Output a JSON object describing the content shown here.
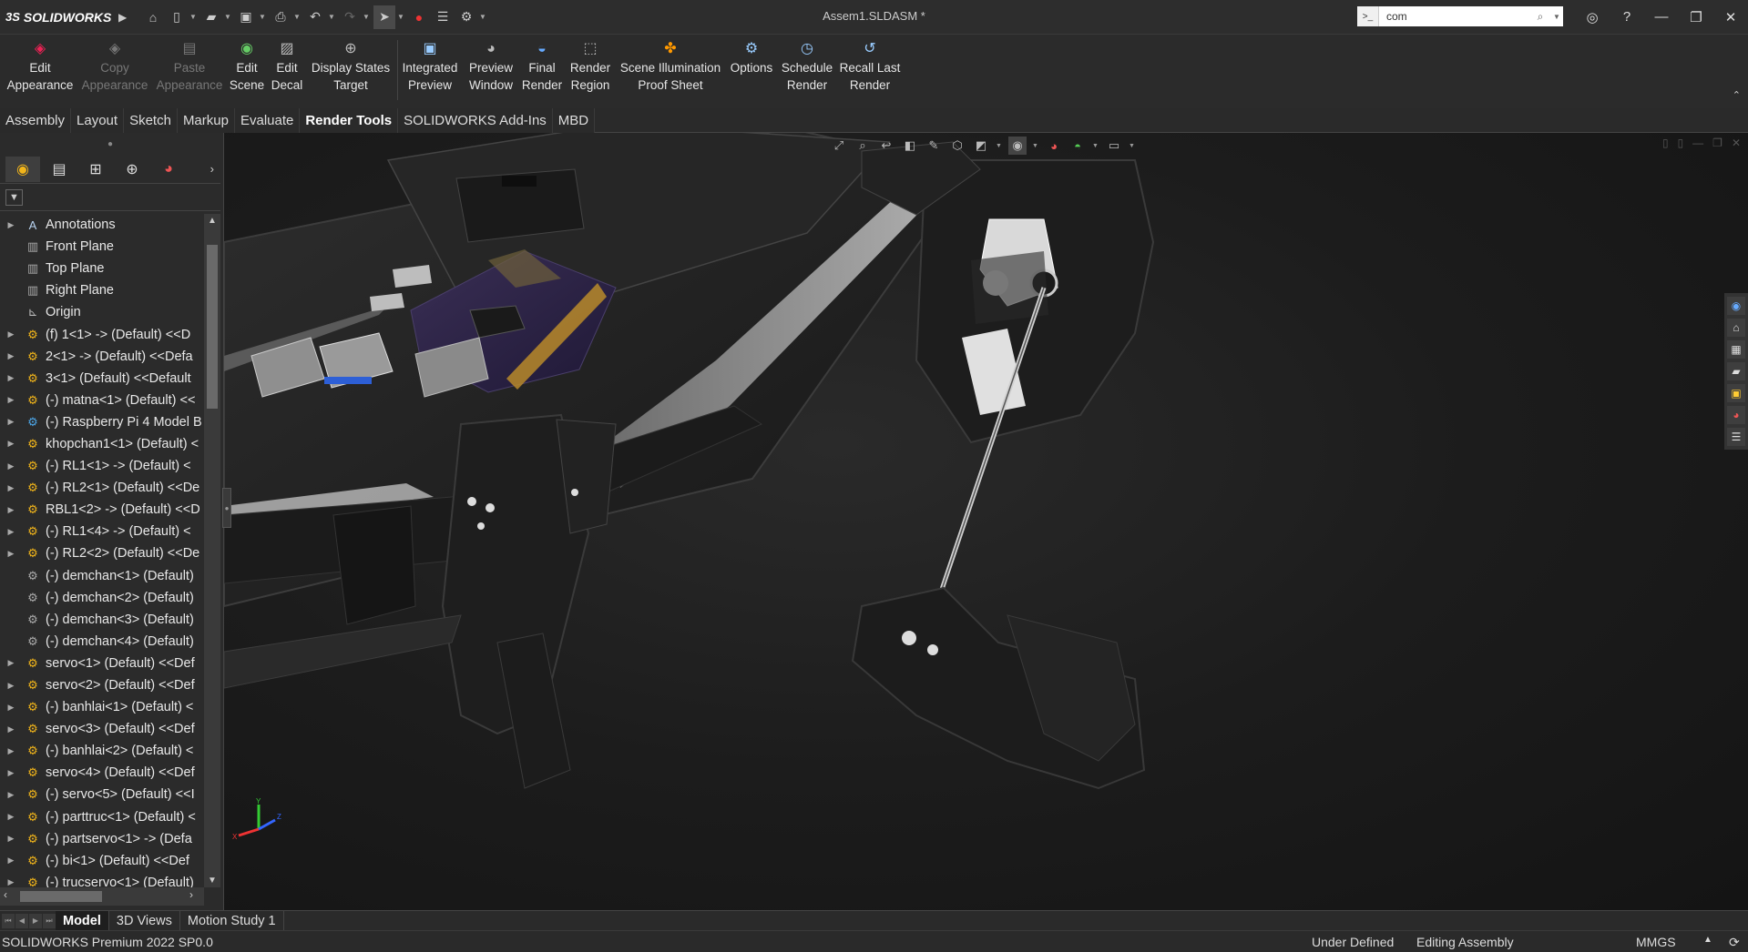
{
  "titlebar": {
    "brand": "SOLIDWORKS",
    "brand_ds": "3S",
    "document_title": "Assem1.SLDASM *",
    "search_value": "com"
  },
  "ribbon": {
    "buttons": [
      {
        "label1": "Edit",
        "label2": "Appearance",
        "icon": "edit-appearance-icon",
        "enabled": true
      },
      {
        "label1": "Copy",
        "label2": "Appearance",
        "icon": "copy-appearance-icon",
        "enabled": false
      },
      {
        "label1": "Paste",
        "label2": "Appearance",
        "icon": "paste-appearance-icon",
        "enabled": false
      },
      {
        "label1": "Edit",
        "label2": "Scene",
        "icon": "edit-scene-icon",
        "enabled": true
      },
      {
        "label1": "Edit",
        "label2": "Decal",
        "icon": "edit-decal-icon",
        "enabled": true
      },
      {
        "label1": "Display States",
        "label2": "Target",
        "icon": "display-states-icon",
        "enabled": true
      },
      {
        "label1": "Integrated",
        "label2": "Preview",
        "icon": "integrated-preview-icon",
        "enabled": true
      },
      {
        "label1": "Preview",
        "label2": "Window",
        "icon": "preview-window-icon",
        "enabled": true
      },
      {
        "label1": "Final",
        "label2": "Render",
        "icon": "final-render-icon",
        "enabled": true
      },
      {
        "label1": "Render",
        "label2": "Region",
        "icon": "render-region-icon",
        "enabled": true
      },
      {
        "label1": "Scene Illumination",
        "label2": "Proof Sheet",
        "icon": "proof-sheet-icon",
        "enabled": true
      },
      {
        "label1": "Options",
        "label2": "",
        "icon": "options-icon",
        "enabled": true
      },
      {
        "label1": "Schedule",
        "label2": "Render",
        "icon": "schedule-render-icon",
        "enabled": true
      },
      {
        "label1": "Recall Last",
        "label2": "Render",
        "icon": "recall-render-icon",
        "enabled": true
      }
    ]
  },
  "command_tabs": [
    "Assembly",
    "Layout",
    "Sketch",
    "Markup",
    "Evaluate",
    "Render Tools",
    "SOLIDWORKS Add-Ins",
    "MBD"
  ],
  "active_command_tab": "Render Tools",
  "feature_tree": {
    "nodes": [
      {
        "label": "Annotations",
        "icon": "annotations-icon",
        "type": "ann",
        "expandable": true
      },
      {
        "label": "Front Plane",
        "icon": "plane-icon",
        "type": "plane",
        "expandable": false
      },
      {
        "label": "Top Plane",
        "icon": "plane-icon",
        "type": "plane",
        "expandable": false
      },
      {
        "label": "Right Plane",
        "icon": "plane-icon",
        "type": "plane",
        "expandable": false
      },
      {
        "label": "Origin",
        "icon": "origin-icon",
        "type": "origin",
        "expandable": false
      },
      {
        "label": "(f) 1<1> -> (Default) <<D",
        "icon": "subassembly-icon",
        "type": "comp",
        "expandable": true
      },
      {
        "label": "2<1> -> (Default) <<Defa",
        "icon": "subassembly-icon",
        "type": "comp",
        "expandable": true
      },
      {
        "label": "3<1> (Default) <<Default",
        "icon": "subassembly-icon",
        "type": "comp",
        "expandable": true
      },
      {
        "label": "(-) matna<1> (Default) <<",
        "icon": "subassembly-icon",
        "type": "comp",
        "expandable": true
      },
      {
        "label": "(-) Raspberry Pi 4 Model B",
        "icon": "subassembly-icon",
        "type": "rpi",
        "expandable": true
      },
      {
        "label": "khopchan1<1> (Default) <",
        "icon": "subassembly-icon",
        "type": "comp",
        "expandable": true
      },
      {
        "label": "(-) RL1<1> -> (Default) <",
        "icon": "subassembly-icon",
        "type": "comp",
        "expandable": true
      },
      {
        "label": "(-) RL2<1> (Default) <<De",
        "icon": "subassembly-icon",
        "type": "comp",
        "expandable": true
      },
      {
        "label": "RBL1<2> -> (Default) <<D",
        "icon": "subassembly-icon",
        "type": "comp",
        "expandable": true
      },
      {
        "label": "(-) RL1<4> -> (Default) <",
        "icon": "subassembly-icon",
        "type": "comp",
        "expandable": true
      },
      {
        "label": "(-) RL2<2> (Default) <<De",
        "icon": "subassembly-icon",
        "type": "comp",
        "expandable": true
      },
      {
        "label": "(-) demchan<1> (Default)",
        "icon": "part-icon",
        "type": "compg",
        "expandable": false
      },
      {
        "label": "(-) demchan<2> (Default)",
        "icon": "part-icon",
        "type": "compg",
        "expandable": false
      },
      {
        "label": "(-) demchan<3> (Default)",
        "icon": "part-icon",
        "type": "compg",
        "expandable": false
      },
      {
        "label": "(-) demchan<4> (Default)",
        "icon": "part-icon",
        "type": "compg",
        "expandable": false
      },
      {
        "label": "servo<1> (Default) <<Def",
        "icon": "subassembly-icon",
        "type": "comp",
        "expandable": true
      },
      {
        "label": "servo<2> (Default) <<Def",
        "icon": "subassembly-icon",
        "type": "comp",
        "expandable": true
      },
      {
        "label": "(-) banhlai<1> (Default) <",
        "icon": "subassembly-icon",
        "type": "comp",
        "expandable": true
      },
      {
        "label": "servo<3> (Default) <<Def",
        "icon": "subassembly-icon",
        "type": "comp",
        "expandable": true
      },
      {
        "label": "(-) banhlai<2> (Default) <",
        "icon": "subassembly-icon",
        "type": "comp",
        "expandable": true
      },
      {
        "label": "servo<4> (Default) <<Def",
        "icon": "subassembly-icon",
        "type": "comp",
        "expandable": true
      },
      {
        "label": "(-) servo<5> (Default) <<I",
        "icon": "subassembly-icon",
        "type": "comp",
        "expandable": true
      },
      {
        "label": "(-) parttruc<1> (Default) <",
        "icon": "subassembly-icon",
        "type": "comp",
        "expandable": true
      },
      {
        "label": "(-) partservo<1> -> (Defa",
        "icon": "subassembly-icon",
        "type": "comp",
        "expandable": true
      },
      {
        "label": "(-) bi<1> (Default) <<Def",
        "icon": "subassembly-icon",
        "type": "comp",
        "expandable": true
      },
      {
        "label": "(-) trucservo<1> (Default)",
        "icon": "subassembly-icon",
        "type": "comp",
        "expandable": true
      }
    ]
  },
  "bottom_tabs": [
    "Model",
    "3D Views",
    "Motion Study 1"
  ],
  "active_bottom_tab": "Model",
  "status": {
    "product": "SOLIDWORKS Premium 2022 SP0.0",
    "definition": "Under Defined",
    "mode": "Editing Assembly",
    "units": "MMGS"
  }
}
